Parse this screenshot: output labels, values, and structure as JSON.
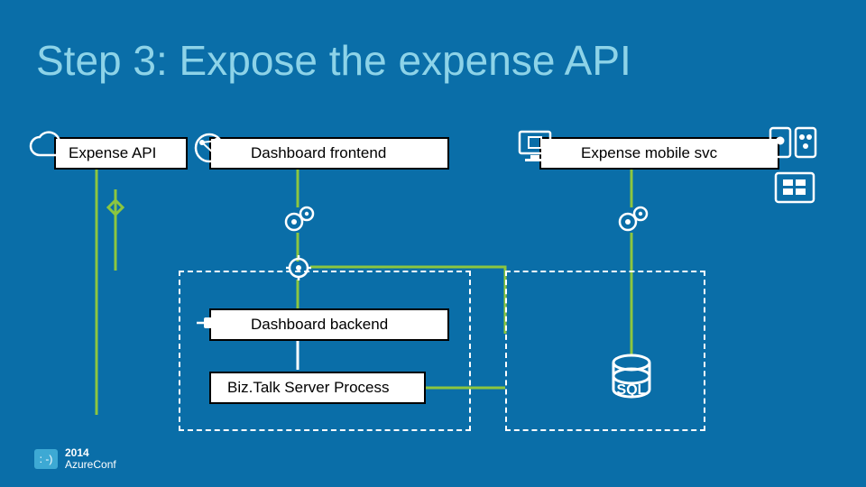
{
  "title": "Step 3: Expose the expense API",
  "boxes": {
    "expense_api": "Expense API",
    "dashboard_frontend": "Dashboard frontend",
    "expense_mobile_svc": "Expense mobile svc",
    "dashboard_backend": "Dashboard backend",
    "biztalk_process": "Biz.Talk Server Process"
  },
  "icons": {
    "cloud": "cloud-icon",
    "globe": "globe-network-icon",
    "monitor": "monitor-icon",
    "phones": "phones-icon",
    "tablet": "tablet-icon",
    "gears": "gears-icon",
    "gear": "gear-icon",
    "plug": "plug-icon",
    "sql": "sql-db-icon"
  },
  "sql_label": "SQL",
  "footer": {
    "year": "2014",
    "conf": "AzureConf",
    "emoji": ": -)"
  }
}
